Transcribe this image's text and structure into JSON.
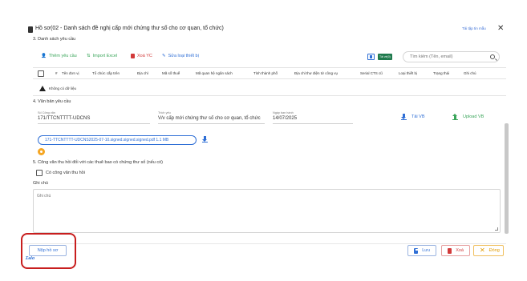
{
  "header": {
    "title": "Hồ sơ(02 - Danh sách đề nghị cấp mới chứng thư số cho cơ quan, tổ chức)",
    "help_link": "Tải tập tin mẫu",
    "close_glyph": "✕"
  },
  "section3": {
    "title": "3. Danh sách yêu cầu",
    "toolbar": {
      "add_label": "Thêm yêu cầu",
      "import_label": "Import Excel",
      "delete_label": "Xoá YC",
      "edit_label": "Sửa loại thiết bị",
      "tag_label": "Tải về(0)"
    },
    "search_placeholder": "Tìm kiếm (Tên, email)",
    "columns": [
      "#",
      "Tên đơn vị",
      "Tổ chức cấp trên",
      "Địa chỉ",
      "Mã số thuế",
      "Mã quan hệ ngân sách",
      "Tỉnh thành phố",
      "Địa chỉ thư điện tử công vụ",
      "Serial CTS cũ",
      "Loại thiết bị",
      "Trạng thái",
      "Ghi chú"
    ],
    "empty_text": "Không có dữ liệu"
  },
  "section4": {
    "title": "4. Văn bản yêu cầu",
    "doc_number_label": "Số Công văn",
    "doc_number_value": "171/TTCNTTTT-UDCNS",
    "summary_label": "Trích yếu",
    "summary_value": "V/v cấp mới chứng thư số cho cơ quan, tổ chức",
    "date_label": "Ngày ban hành",
    "date_value": "14/07/2025",
    "download_label": "Tải VB",
    "upload_label": "Upload VB",
    "file_name": "171-TTCNTTTT-UDCNS2025-07-10.signed.signed.signed.pdf",
    "file_size": "1.1 MB"
  },
  "section5": {
    "title": "5. Công văn thu hồi đối với các thuê bao có chứng thư số (nếu có)",
    "checkbox_label": "Có công văn thu hồi"
  },
  "notes": {
    "label": "Ghi chú",
    "placeholder": "Ghi chú"
  },
  "footer": {
    "submit_label": "Nộp hồ sơ",
    "logo_text": "Σalo",
    "save_label": "Lưu",
    "delete_label": "Xoá",
    "close_label": "Đóng"
  },
  "colors": {
    "accent": "#2f6fd6",
    "success": "#3aa55a",
    "danger": "#d23a3a",
    "warning": "#e09a00",
    "highlight_frame": "#c81e1e"
  }
}
